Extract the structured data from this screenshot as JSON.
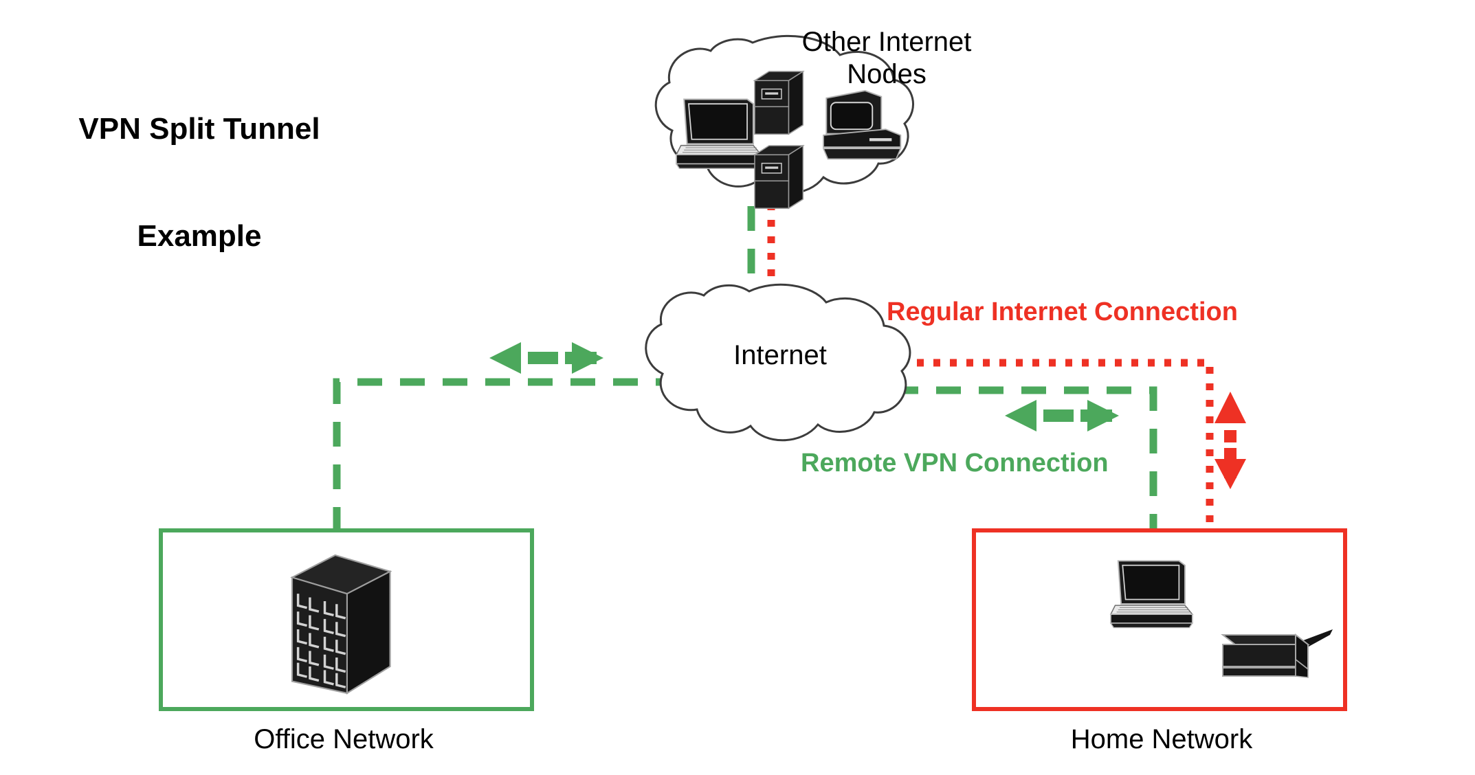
{
  "diagram": {
    "title": "VPN Split Tunnel\nExample",
    "title_line1": "VPN Split Tunnel",
    "title_line2": "Example",
    "background_color": "#FFFFFF"
  },
  "labels": {
    "other_internet_nodes": "Other Internet\nNodes",
    "internet_cloud": "Internet",
    "regular_internet_connection": "Regular Internet Connection",
    "remote_vpn_connection": "Remote VPN Connection",
    "office_network": "Office Network",
    "home_network": "Home Network"
  },
  "colors": {
    "vpn_green": "#4CA85C",
    "internet_red": "#EE3124",
    "device_black": "#1A1A1A",
    "cloud_outline": "#3C3C3C",
    "text_black": "#000000"
  },
  "nodes": [
    {
      "id": "other-internet-nodes-cloud",
      "type": "cloud",
      "label": "Other Internet Nodes",
      "contents": [
        "laptop",
        "server-tower-top",
        "server-tower-bottom",
        "desktop-computer"
      ]
    },
    {
      "id": "internet-cloud",
      "type": "cloud",
      "label": "Internet",
      "contents": []
    },
    {
      "id": "office-network-box",
      "type": "boundary-box",
      "label": "Office Network",
      "border_color": "#4CA85C",
      "contents": [
        "server-rack"
      ]
    },
    {
      "id": "home-network-box",
      "type": "boundary-box",
      "label": "Home Network",
      "border_color": "#EE3124",
      "contents": [
        "laptop",
        "modem-router"
      ]
    }
  ],
  "connections": [
    {
      "id": "vpn-upper-link",
      "style": "dashed",
      "color": "#4CA85C",
      "from": "internet-cloud",
      "to": "other-internet-nodes-cloud"
    },
    {
      "id": "regular-upper-link",
      "style": "dotted",
      "color": "#EE3124",
      "from": "internet-cloud",
      "to": "other-internet-nodes-cloud"
    },
    {
      "id": "vpn-office-link",
      "style": "dashed",
      "color": "#4CA85C",
      "from": "internet-cloud",
      "to": "office-network-box"
    },
    {
      "id": "vpn-home-link",
      "style": "dashed",
      "color": "#4CA85C",
      "from": "internet-cloud",
      "to": "home-network-box"
    },
    {
      "id": "regular-home-link",
      "style": "dotted",
      "color": "#EE3124",
      "from": "internet-cloud",
      "to": "home-network-box"
    }
  ],
  "arrows": [
    {
      "id": "vpn-office-bidirectional-arrow",
      "direction": "horizontal-both",
      "color": "#4CA85C"
    },
    {
      "id": "vpn-home-bidirectional-arrow",
      "direction": "horizontal-both",
      "color": "#4CA85C"
    },
    {
      "id": "regular-home-bidirectional-arrow",
      "direction": "vertical-both",
      "color": "#EE3124"
    }
  ]
}
